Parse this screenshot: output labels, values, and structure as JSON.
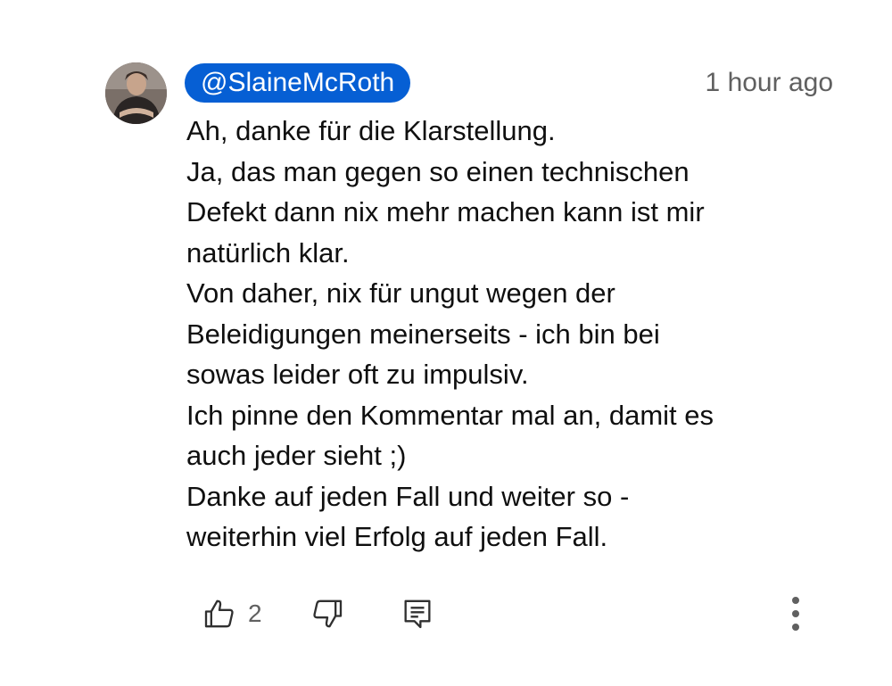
{
  "comment": {
    "author": "@SlaineMcRoth",
    "timestamp": "1 hour ago",
    "lines": [
      "Ah, danke für die Klarstellung.",
      "Ja, das man gegen so einen technischen",
      "Defekt dann nix mehr machen kann ist mir",
      "natürlich klar.",
      "Von daher, nix für ungut wegen der",
      "Beleidigungen meinerseits - ich bin bei",
      "sowas leider oft zu impulsiv.",
      "Ich pinne den Kommentar mal an, damit es",
      "auch jeder sieht ;)",
      "Danke auf jeden Fall und weiter so -",
      "weiterhin viel Erfolg auf jeden Fall."
    ],
    "like_count": "2"
  },
  "icons": {
    "like": "thumb-up-icon",
    "dislike": "thumb-down-icon",
    "reply": "reply-comment-icon",
    "more": "more-vertical-icon"
  },
  "colors": {
    "author_chip": "#065fd4",
    "text": "#0f0f0f",
    "secondary": "#606060"
  }
}
